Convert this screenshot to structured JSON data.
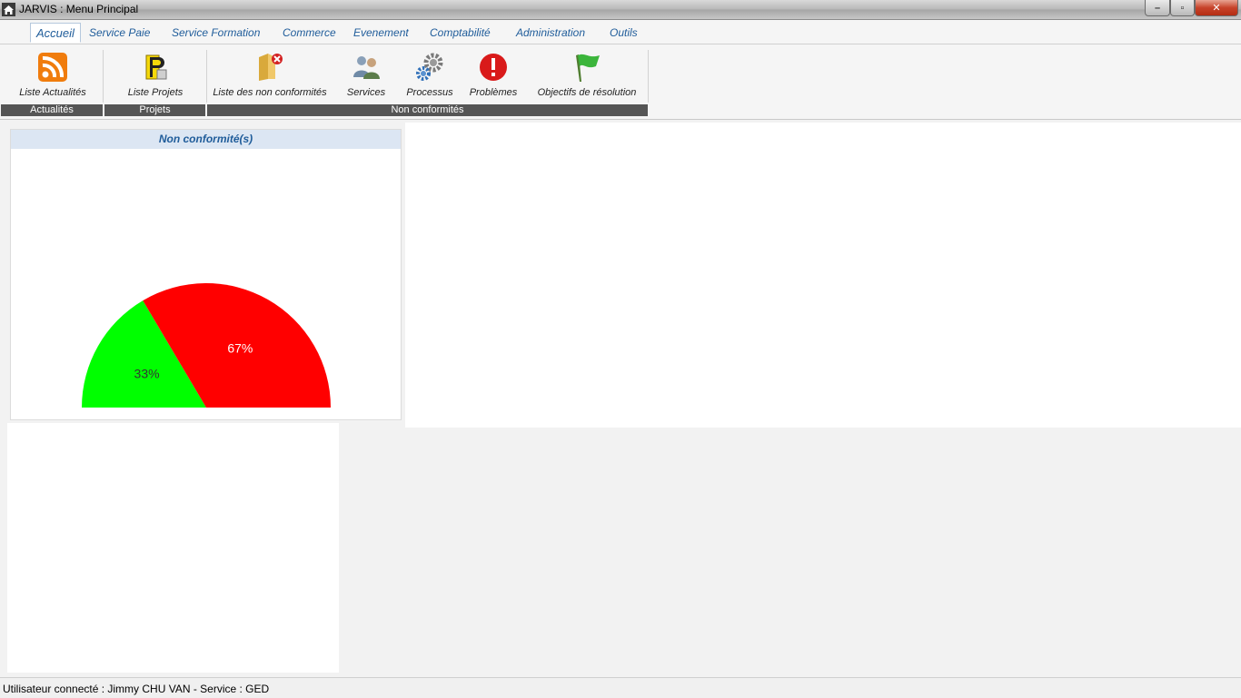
{
  "window": {
    "title": "JARVIS : Menu Principal",
    "controls": {
      "minimize": "–",
      "maximize": "▫",
      "close": "✕"
    }
  },
  "menu": {
    "tabs": [
      {
        "label": "Accueil",
        "active": true
      },
      {
        "label": "Service Paie"
      },
      {
        "label": "Service Formation"
      },
      {
        "label": "Commerce"
      },
      {
        "label": "Evenement"
      },
      {
        "label": "Comptabilité"
      },
      {
        "label": "Administration"
      },
      {
        "label": "Outils"
      }
    ]
  },
  "ribbon": {
    "buttons": [
      {
        "label": "Liste Actualités",
        "icon": "rss-icon"
      },
      {
        "label": "Liste Projets",
        "icon": "projects-icon"
      },
      {
        "label": "Liste des non conformités",
        "icon": "folder-error-icon"
      },
      {
        "label": "Services",
        "icon": "users-icon"
      },
      {
        "label": "Processus",
        "icon": "gears-icon"
      },
      {
        "label": "Problèmes",
        "icon": "warning-icon"
      },
      {
        "label": "Objectifs de résolution",
        "icon": "green-flag-icon"
      }
    ],
    "groups": [
      {
        "label": "Actualités"
      },
      {
        "label": "Projets"
      },
      {
        "label": "Non conformités"
      }
    ]
  },
  "panel": {
    "title": "Non conformité(s)"
  },
  "chart_data": {
    "type": "pie",
    "shape": "half-pie",
    "slices": [
      {
        "label": "33%",
        "value": 33,
        "color": "#00ff00"
      },
      {
        "label": "67%",
        "value": 67,
        "color": "#ff0000"
      }
    ]
  },
  "status": {
    "text": "Utilisateur connecté : Jimmy CHU VAN - Service : GED"
  }
}
